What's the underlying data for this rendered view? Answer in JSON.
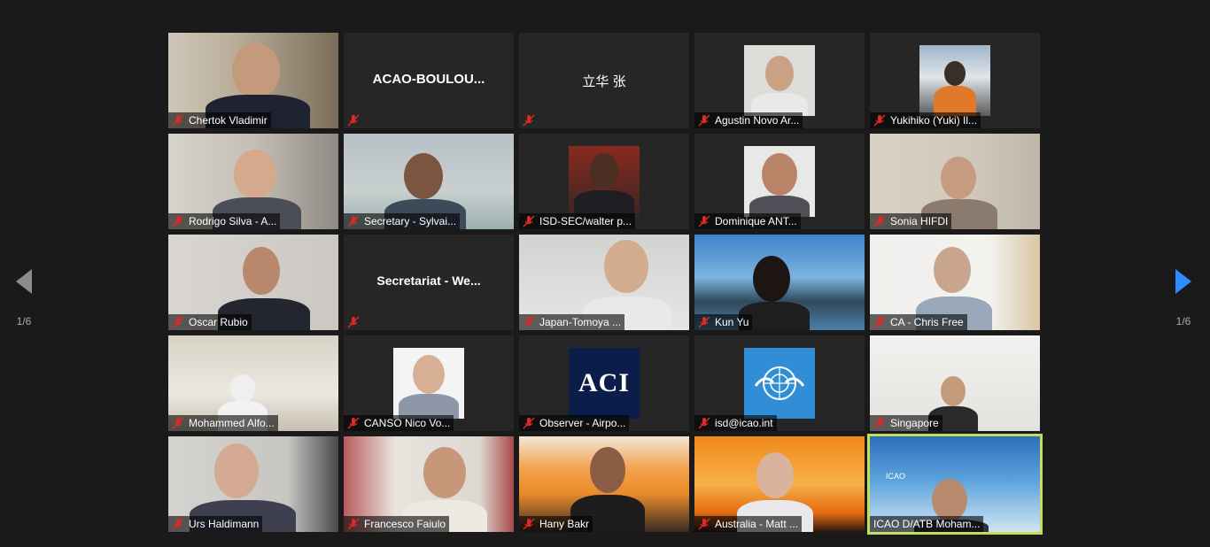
{
  "navigation": {
    "left_page": "1/6",
    "right_page": "1/6",
    "accent_color": "#2d8cff"
  },
  "participants": [
    {
      "name": "Chertok Vladimir",
      "muted": true
    },
    {
      "name": "ACAO-BOULOU...",
      "muted": true
    },
    {
      "name": "立华 张",
      "muted": true
    },
    {
      "name": "Agustin Novo Ar...",
      "muted": true
    },
    {
      "name": "Yukihiko (Yuki) Il...",
      "muted": true
    },
    {
      "name": "Rodrigo Silva - A...",
      "muted": true
    },
    {
      "name": "Secretary - Sylvai...",
      "muted": true
    },
    {
      "name": "ISD-SEC/walter p...",
      "muted": true
    },
    {
      "name": "Dominique ANT...",
      "muted": true
    },
    {
      "name": "Sonia HIFDI",
      "muted": true
    },
    {
      "name": "Oscar Rubio",
      "muted": true
    },
    {
      "name": "Secretariat  -  We...",
      "muted": true
    },
    {
      "name": "Japan-Tomoya ...",
      "muted": true
    },
    {
      "name": "Kun Yu",
      "muted": true
    },
    {
      "name": "CA - Chris Free",
      "muted": true
    },
    {
      "name": "Mohammed Alfo...",
      "muted": true
    },
    {
      "name": "CANSO Nico Vo...",
      "muted": true
    },
    {
      "name": "Observer - Airpo...",
      "muted": true
    },
    {
      "name": "isd@icao.int",
      "muted": true
    },
    {
      "name": "Singapore",
      "muted": true
    },
    {
      "name": "Urs Haldimann",
      "muted": true
    },
    {
      "name": "Francesco Faiulo",
      "muted": true
    },
    {
      "name": "Hany Bakr",
      "muted": true
    },
    {
      "name": "Australia - Matt ...",
      "muted": true
    },
    {
      "name": "ICAO D/ATB Moham...",
      "muted": true,
      "active_speaker": true
    }
  ],
  "logos": {
    "aci": "ACI",
    "icao_small": "ICAO"
  },
  "colors": {
    "active_border": "#c6dd5a",
    "tile_bg": "#262626",
    "mute_icon": "#e02828"
  }
}
